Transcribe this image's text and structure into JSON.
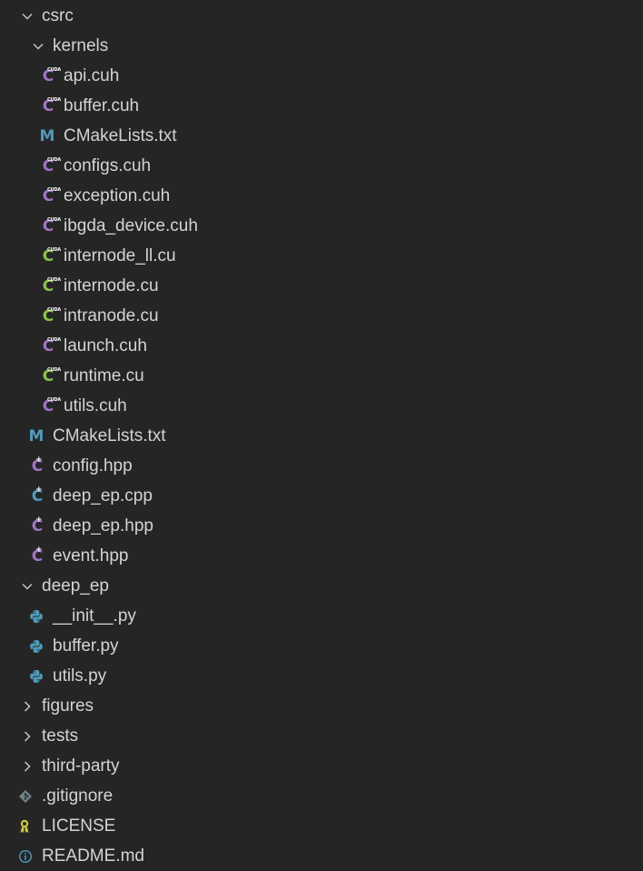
{
  "colors": {
    "background": "#252526",
    "text": "#d4d4d4",
    "chevron": "#c5c5c5",
    "cuda_header_icon": "#a074c4",
    "cuda_source_icon": "#8dc149",
    "cpp_header_icon": "#a074c4",
    "cpp_source_icon": "#519aba",
    "cmake_icon": "#519aba",
    "python_icon": "#519aba",
    "git_icon": "#6d8086",
    "license_icon": "#cbcb41",
    "info_icon": "#519aba"
  },
  "explorer": {
    "items": [
      {
        "label": "csrc",
        "type": "folder",
        "expanded": true,
        "icon": "chevron-down-icon"
      },
      {
        "label": "kernels",
        "type": "folder",
        "expanded": true,
        "icon": "chevron-down-icon"
      },
      {
        "label": "api.cuh",
        "type": "file",
        "icon": "cuda-header-icon"
      },
      {
        "label": "buffer.cuh",
        "type": "file",
        "icon": "cuda-header-icon"
      },
      {
        "label": "CMakeLists.txt",
        "type": "file",
        "icon": "cmake-icon"
      },
      {
        "label": "configs.cuh",
        "type": "file",
        "icon": "cuda-header-icon"
      },
      {
        "label": "exception.cuh",
        "type": "file",
        "icon": "cuda-header-icon"
      },
      {
        "label": "ibgda_device.cuh",
        "type": "file",
        "icon": "cuda-header-icon"
      },
      {
        "label": "internode_ll.cu",
        "type": "file",
        "icon": "cuda-source-icon"
      },
      {
        "label": "internode.cu",
        "type": "file",
        "icon": "cuda-source-icon"
      },
      {
        "label": "intranode.cu",
        "type": "file",
        "icon": "cuda-source-icon"
      },
      {
        "label": "launch.cuh",
        "type": "file",
        "icon": "cuda-header-icon"
      },
      {
        "label": "runtime.cu",
        "type": "file",
        "icon": "cuda-source-icon"
      },
      {
        "label": "utils.cuh",
        "type": "file",
        "icon": "cuda-header-icon"
      },
      {
        "label": "CMakeLists.txt",
        "type": "file",
        "icon": "cmake-icon"
      },
      {
        "label": "config.hpp",
        "type": "file",
        "icon": "cpp-header-icon"
      },
      {
        "label": "deep_ep.cpp",
        "type": "file",
        "icon": "cpp-source-icon"
      },
      {
        "label": "deep_ep.hpp",
        "type": "file",
        "icon": "cpp-header-icon"
      },
      {
        "label": "event.hpp",
        "type": "file",
        "icon": "cpp-header-icon"
      },
      {
        "label": "deep_ep",
        "type": "folder",
        "expanded": true,
        "icon": "chevron-down-icon"
      },
      {
        "label": "__init__.py",
        "type": "file",
        "icon": "python-icon"
      },
      {
        "label": "buffer.py",
        "type": "file",
        "icon": "python-icon"
      },
      {
        "label": "utils.py",
        "type": "file",
        "icon": "python-icon"
      },
      {
        "label": "figures",
        "type": "folder",
        "expanded": false,
        "icon": "chevron-right-icon"
      },
      {
        "label": "tests",
        "type": "folder",
        "expanded": false,
        "icon": "chevron-right-icon"
      },
      {
        "label": "third-party",
        "type": "folder",
        "expanded": false,
        "icon": "chevron-right-icon"
      },
      {
        "label": ".gitignore",
        "type": "file",
        "icon": "git-icon"
      },
      {
        "label": "LICENSE",
        "type": "file",
        "icon": "license-icon"
      },
      {
        "label": "README.md",
        "type": "file",
        "icon": "info-icon"
      }
    ]
  }
}
